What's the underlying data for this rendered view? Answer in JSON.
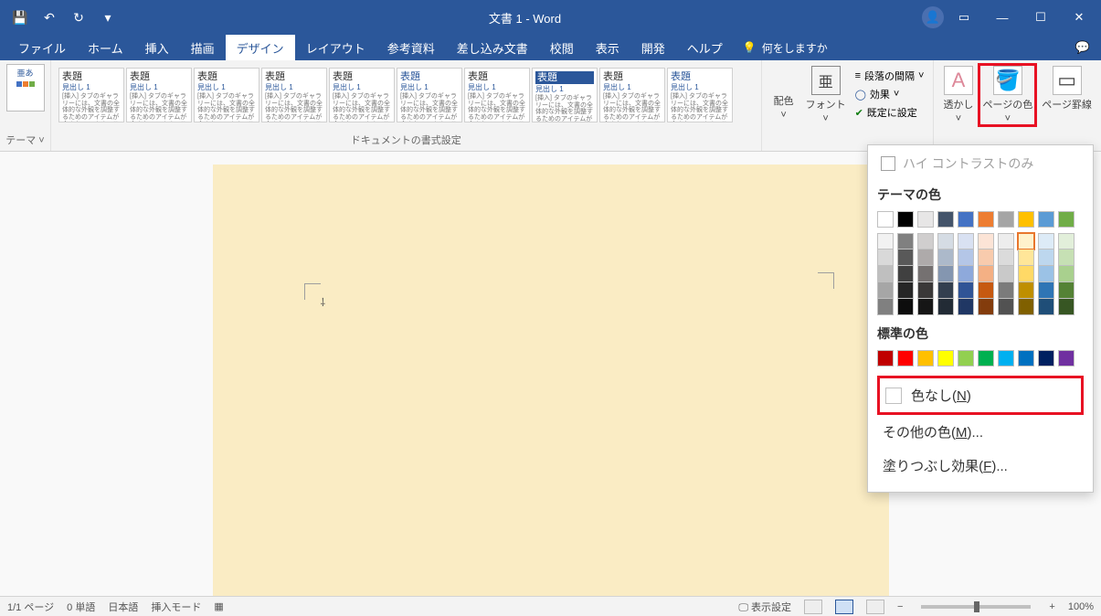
{
  "titlebar": {
    "title": "文書 1  -  Word",
    "qat": {
      "save": "💾",
      "undo": "↶",
      "redo": "↻",
      "more": "▾"
    },
    "win": {
      "ribbonopts": "▭",
      "min": "—",
      "max": "☐",
      "close": "✕"
    }
  },
  "tabs": {
    "items": [
      "ファイル",
      "ホーム",
      "挿入",
      "描画",
      "デザイン",
      "レイアウト",
      "参考資料",
      "差し込み文書",
      "校閲",
      "表示",
      "開発",
      "ヘルプ"
    ],
    "active_index": 4,
    "tell_me_placeholder": "何をしますか",
    "share_icon": "💬"
  },
  "ribbon": {
    "theme_label": "テーマ",
    "gallery_label": "ドキュメントの書式設定",
    "style_heading": "表題",
    "style_sub": "見出し 1",
    "style_body": "[挿入] タブのギャラリーには、文書の全体的な外観を調整するためのアイテムが含まれています。これらの",
    "colors_label": "配色",
    "fonts_label": "フォント",
    "para_spacing": "段落の間隔",
    "effects": "効果",
    "set_default": "既定に設定",
    "watermark": "透かし",
    "page_color": "ページの色",
    "page_border": "ページ罫線"
  },
  "color_panel": {
    "high_contrast": "ハイ コントラストのみ",
    "theme_colors": "テーマの色",
    "standard_colors": "標準の色",
    "no_color": "色なし(",
    "no_color_u": "N",
    "no_color_end": ")",
    "more_colors": "その他の色(",
    "more_colors_u": "M",
    "more_colors_end": ")...",
    "fill_effects": "塗りつぶし効果(",
    "fill_effects_u": "F",
    "fill_effects_end": ")...",
    "theme_row": [
      "#ffffff",
      "#000000",
      "#e7e6e6",
      "#44546a",
      "#4472c4",
      "#ed7d31",
      "#a5a5a5",
      "#ffc000",
      "#5b9bd5",
      "#70ad47"
    ],
    "shade_cols": [
      [
        "#f2f2f2",
        "#d9d9d9",
        "#bfbfbf",
        "#a6a6a6",
        "#808080"
      ],
      [
        "#808080",
        "#595959",
        "#404040",
        "#262626",
        "#0d0d0d"
      ],
      [
        "#d0cece",
        "#aeaaaa",
        "#757171",
        "#3a3838",
        "#161616"
      ],
      [
        "#d5dce4",
        "#acb9ca",
        "#8496b0",
        "#333f4f",
        "#222b35"
      ],
      [
        "#d9e1f2",
        "#b4c6e7",
        "#8ea9db",
        "#305496",
        "#203764"
      ],
      [
        "#fce4d6",
        "#f8cbad",
        "#f4b084",
        "#c65911",
        "#833c0c"
      ],
      [
        "#ededed",
        "#dbdbdb",
        "#c9c9c9",
        "#7b7b7b",
        "#525252"
      ],
      [
        "#fff2cc",
        "#ffe699",
        "#ffd966",
        "#bf8f00",
        "#806000"
      ],
      [
        "#ddebf7",
        "#bdd7ee",
        "#9bc2e6",
        "#2f75b5",
        "#1f4e78"
      ],
      [
        "#e2efda",
        "#c6e0b4",
        "#a9d08e",
        "#548235",
        "#375623"
      ]
    ],
    "standard_row": [
      "#c00000",
      "#ff0000",
      "#ffc000",
      "#ffff00",
      "#92d050",
      "#00b050",
      "#00b0f0",
      "#0070c0",
      "#002060",
      "#7030a0"
    ]
  },
  "statusbar": {
    "page": "1/1 ページ",
    "words": "0 単語",
    "lang": "日本語",
    "mode": "挿入モード",
    "display": "表示設定",
    "zoom": "100%"
  }
}
